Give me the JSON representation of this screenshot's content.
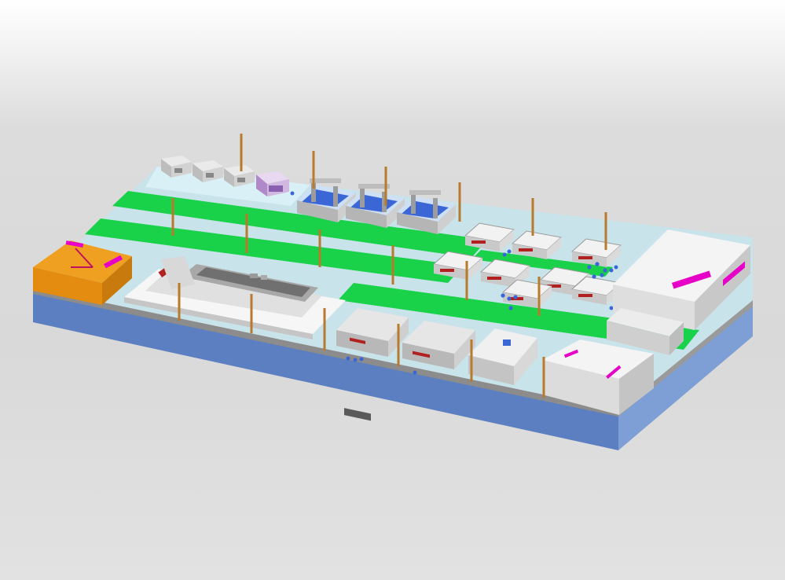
{
  "scene": {
    "colors": {
      "slab_top": "#c8e3ea",
      "slab_front": "#5b7fc0",
      "slab_side": "#7d9fd6",
      "lane": "#19d24a",
      "walkway": "#d9f0f6",
      "orange_block": "#f0a020",
      "building": "#f4f4f4",
      "building_shade": "#cfcfcf",
      "sign": "#e600c8",
      "machine": "#dcdcdc",
      "machine_dark": "#8a8a8a",
      "blue_parts": "#3b66d6",
      "red_parts": "#b32020",
      "pillar": "#b87a2c"
    },
    "machine_rows": [
      {
        "name": "back-row-small-enclosures",
        "count": 4
      },
      {
        "name": "back-row-blue-gantries",
        "count": 3
      },
      {
        "name": "right-cluster-frames",
        "count": 8
      },
      {
        "name": "front-row-gantries",
        "count": 2
      }
    ],
    "pillars": 18
  }
}
